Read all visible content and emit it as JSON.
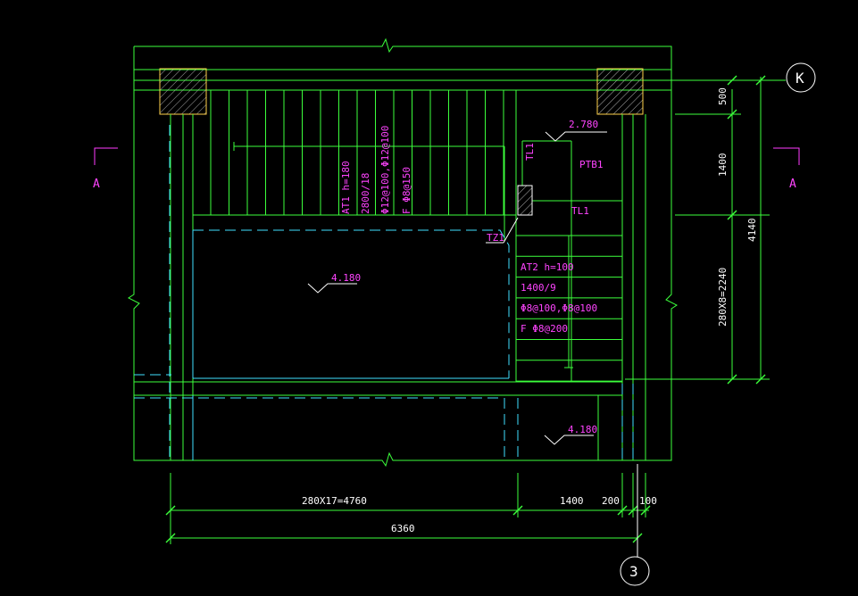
{
  "grid_axes": {
    "top_right": "K",
    "bottom": "3"
  },
  "section_marks": {
    "left": "A",
    "right": "A"
  },
  "elevations": {
    "landing_top": "2.780",
    "floor_mid": "4.180",
    "floor_bottom": "4.180"
  },
  "members": {
    "ptb": "PTB1",
    "tl_vertical": "TL1",
    "tl_horizontal": "TL1",
    "tz": "TZ1"
  },
  "stair_at1": {
    "line1": "AT1 h=180",
    "line2": "2800/18",
    "line3": "Φ12@100,Φ12@100",
    "line4": "F Φ8@150"
  },
  "stair_at2": {
    "line1": "AT2 h=100",
    "line2": "1400/9",
    "line3": "Φ8@100,Φ8@100",
    "line4": "F Φ8@200"
  },
  "dims_bottom": {
    "run": "280X17=4760",
    "landing": "1400",
    "wall": "200",
    "edge": "100",
    "total": "6360"
  },
  "dims_right": {
    "d1": "500",
    "d2": "1400",
    "d3": "280X8=2240",
    "total": "4140"
  },
  "colors": {
    "outline": "#3cff3c",
    "annotation": "#ff44ff",
    "hidden": "#40e0ff",
    "background": "#000000"
  }
}
